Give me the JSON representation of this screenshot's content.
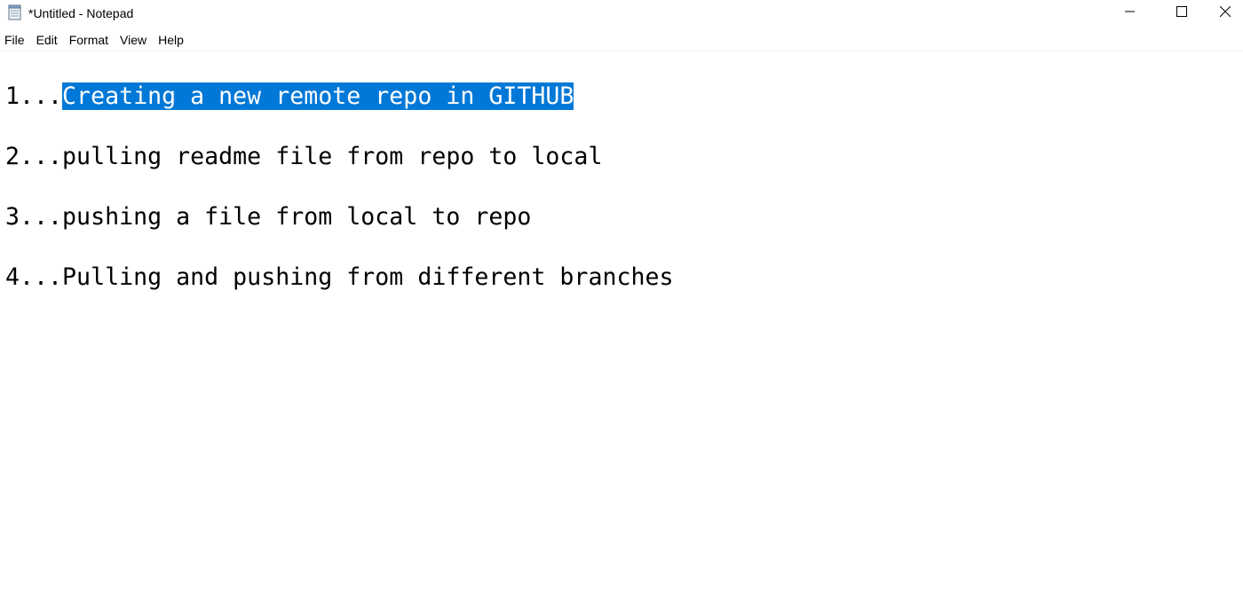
{
  "window": {
    "title": "*Untitled - Notepad",
    "icon": "notepad-icon",
    "controls": {
      "minimize": "minimize-icon",
      "maximize": "maximize-icon",
      "close": "close-icon"
    }
  },
  "menu": {
    "items": [
      "File",
      "Edit",
      "Format",
      "View",
      "Help"
    ]
  },
  "editor": {
    "lines": [
      {
        "prefix": "1...",
        "text": "Creating a new remote repo in GITHUB",
        "selected": true
      },
      {
        "prefix": "2...",
        "text": "pulling readme file from repo to local",
        "selected": false
      },
      {
        "prefix": "3...",
        "text": "pushing a file from local to repo",
        "selected": false
      },
      {
        "prefix": "4...",
        "text": "Pulling and pushing from different branches",
        "selected": false
      }
    ]
  },
  "colors": {
    "selection_background": "#0078d7",
    "selection_text": "#ffffff",
    "text": "#000000",
    "background": "#ffffff"
  }
}
